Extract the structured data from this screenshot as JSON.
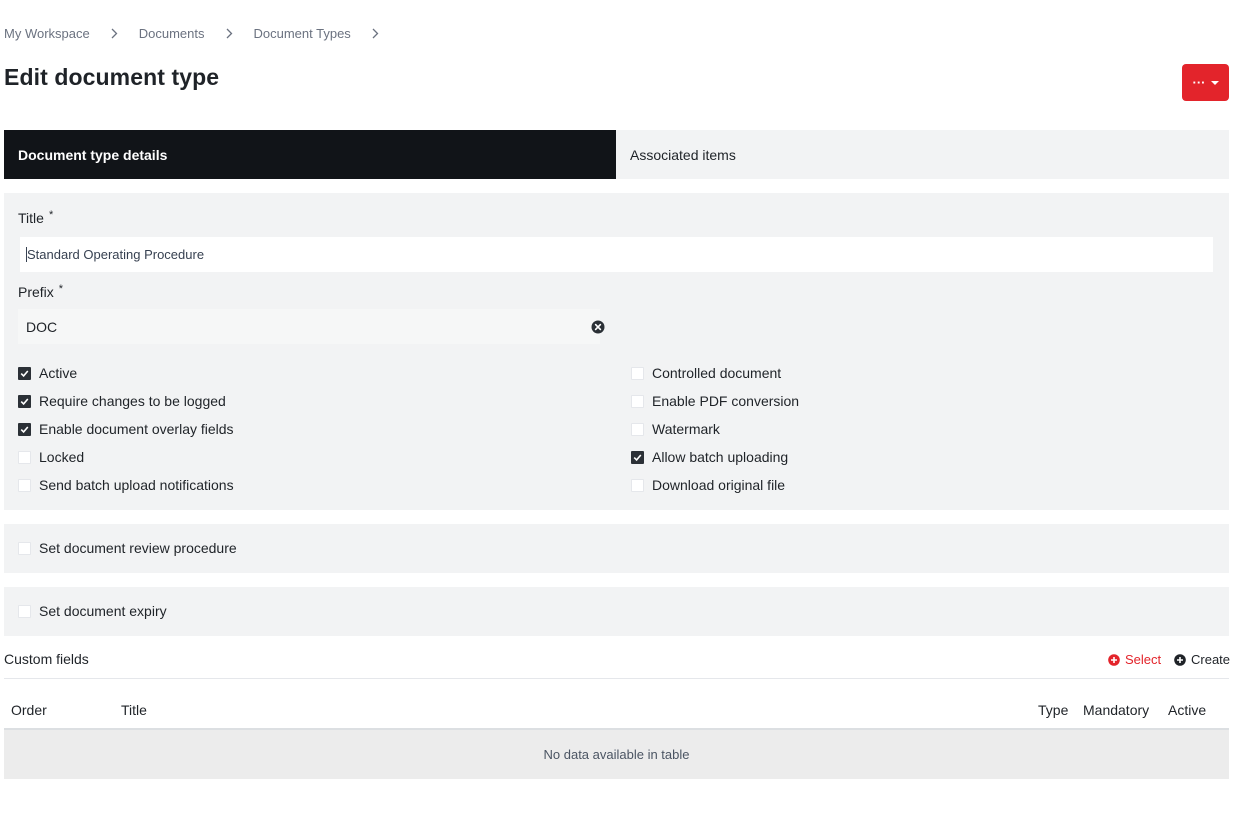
{
  "breadcrumb": {
    "items": [
      "My Workspace",
      "Documents",
      "Document Types"
    ]
  },
  "page_title": "Edit document type",
  "actions_button": {
    "label": "···"
  },
  "tabs": [
    {
      "label": "Document type details",
      "active": true
    },
    {
      "label": "Associated items",
      "active": false
    }
  ],
  "form": {
    "title_label": "Title",
    "title_value": "Standard Operating Procedure",
    "prefix_label": "Prefix",
    "prefix_value": "DOC",
    "required_marker": "*"
  },
  "options_left": [
    {
      "label": "Active",
      "checked": true
    },
    {
      "label": "Require changes to be logged",
      "checked": true
    },
    {
      "label": "Enable document overlay fields",
      "checked": true
    },
    {
      "label": "Locked",
      "checked": false
    },
    {
      "label": "Send batch upload notifications",
      "checked": false
    }
  ],
  "options_right": [
    {
      "label": "Controlled document",
      "checked": false
    },
    {
      "label": "Enable PDF conversion",
      "checked": false
    },
    {
      "label": "Watermark",
      "checked": false
    },
    {
      "label": "Allow batch uploading",
      "checked": true
    },
    {
      "label": "Download original file",
      "checked": false
    }
  ],
  "review_section": {
    "label": "Set document review procedure",
    "checked": false
  },
  "expiry_section": {
    "label": "Set document expiry",
    "checked": false
  },
  "custom_fields": {
    "title": "Custom fields",
    "select_label": "Select",
    "create_label": "Create",
    "columns": [
      "Order",
      "Title",
      "Type",
      "Mandatory",
      "Active"
    ],
    "empty_message": "No data available in table"
  },
  "colors": {
    "accent": "#e3242b",
    "active_tab": "#111418",
    "panel": "#f2f3f4"
  }
}
